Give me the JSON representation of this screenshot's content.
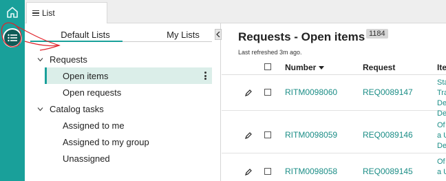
{
  "rail": {
    "home_icon": "home-icon",
    "list_icon": "list-icon"
  },
  "tab": {
    "label": "List"
  },
  "panel": {
    "segments": {
      "default": "Default Lists",
      "my": "My Lists"
    },
    "groups": [
      {
        "label": "Requests",
        "items": [
          {
            "label": "Open items",
            "active": true
          },
          {
            "label": "Open requests",
            "active": false
          }
        ]
      },
      {
        "label": "Catalog tasks",
        "items": [
          {
            "label": "Assigned to me",
            "active": false
          },
          {
            "label": "Assigned to my group",
            "active": false
          },
          {
            "label": "Unassigned",
            "active": false
          }
        ]
      }
    ]
  },
  "main": {
    "title": "Requests - Open items",
    "count": "1184",
    "refreshed": "Last refreshed 3m ago.",
    "columns": {
      "number": "Number",
      "request": "Request",
      "item": "Ite"
    },
    "rows": [
      {
        "number": "RITM0098060",
        "request": "REQ0089147",
        "item_lines": [
          "Sta",
          "Tra",
          "De",
          "De"
        ]
      },
      {
        "number": "RITM0098059",
        "request": "REQ0089146",
        "item_lines": [
          "Of",
          "a U",
          "De"
        ]
      },
      {
        "number": "RITM0098058",
        "request": "REQ0089145",
        "item_lines": [
          "Of",
          "a U"
        ]
      }
    ]
  },
  "colors": {
    "accent": "#19a09a",
    "rail": "#19a09a",
    "link": "#1b8d86",
    "annotation": "#e0222a"
  }
}
